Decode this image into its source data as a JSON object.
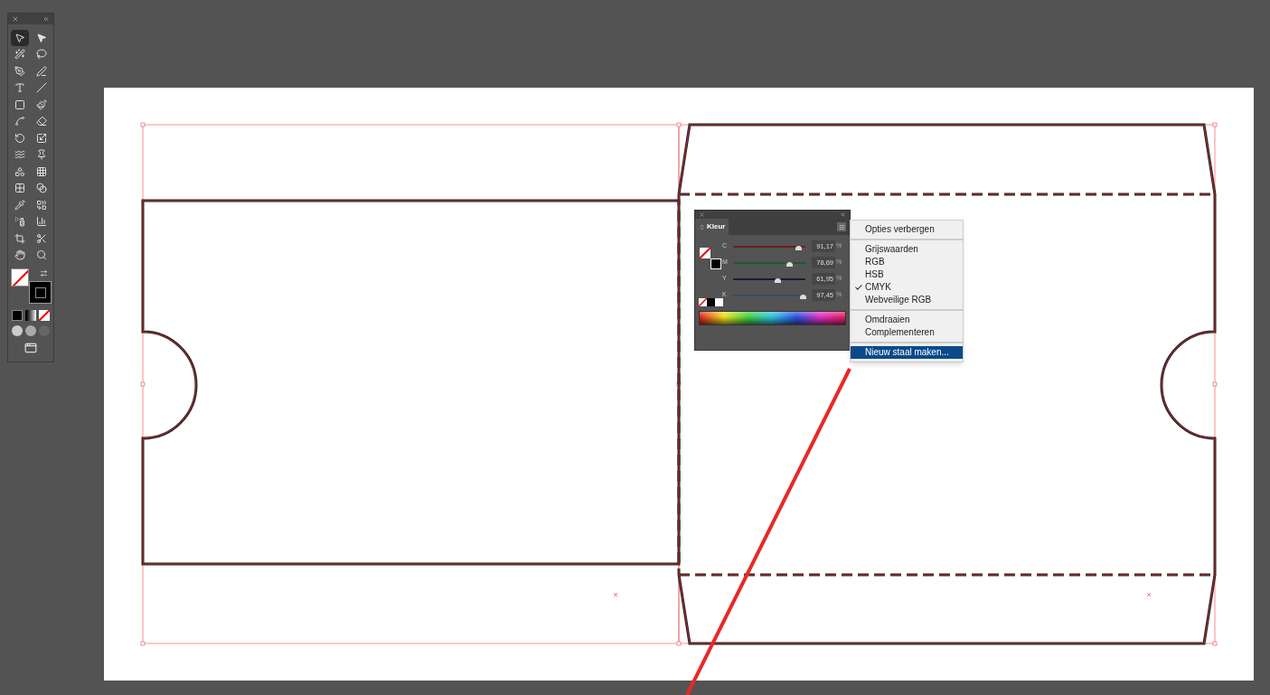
{
  "toolbar": {
    "tools": [
      {
        "selected": true
      },
      {
        "selected": false
      },
      {
        "selected": false
      },
      {
        "selected": false
      },
      {
        "selected": false
      },
      {
        "selected": false
      },
      {
        "selected": false
      },
      {
        "selected": false
      },
      {
        "selected": false
      },
      {
        "selected": false
      },
      {
        "selected": false
      },
      {
        "selected": false
      },
      {
        "selected": false
      },
      {
        "selected": false
      },
      {
        "selected": false
      },
      {
        "selected": false
      },
      {
        "selected": false
      },
      {
        "selected": false
      },
      {
        "selected": false
      },
      {
        "selected": false
      },
      {
        "selected": false
      },
      {
        "selected": false
      },
      {
        "selected": false
      },
      {
        "selected": false
      },
      {
        "selected": false
      },
      {
        "selected": false
      },
      {
        "selected": false
      },
      {
        "selected": false
      }
    ]
  },
  "color_panel": {
    "tab": "Kleur",
    "channels": [
      {
        "name": "C",
        "value": "91,17",
        "unit": "%",
        "level": 0.91,
        "color": "#6b1f1f"
      },
      {
        "name": "M",
        "value": "78,69",
        "unit": "%",
        "level": 0.79,
        "color": "#1f5a2a"
      },
      {
        "name": "Y",
        "value": "61,95",
        "unit": "%",
        "level": 0.62,
        "color": "#1a1a3a"
      },
      {
        "name": "K",
        "value": "97,45",
        "unit": "%",
        "level": 0.97,
        "color": "#3a4a66"
      }
    ]
  },
  "panel_menu": {
    "sections": [
      [
        {
          "label": "Opties verbergen",
          "checked": false,
          "selected": false
        }
      ],
      [
        {
          "label": "Grijswaarden",
          "checked": false,
          "selected": false
        },
        {
          "label": "RGB",
          "checked": false,
          "selected": false
        },
        {
          "label": "HSB",
          "checked": false,
          "selected": false
        },
        {
          "label": "CMYK",
          "checked": true,
          "selected": false
        },
        {
          "label": "Webveilige RGB",
          "checked": false,
          "selected": false
        }
      ],
      [
        {
          "label": "Omdraaien",
          "checked": false,
          "selected": false
        },
        {
          "label": "Complementeren",
          "checked": false,
          "selected": false
        }
      ],
      [
        {
          "label": "Nieuw staal maken...",
          "checked": false,
          "selected": true
        }
      ]
    ]
  }
}
